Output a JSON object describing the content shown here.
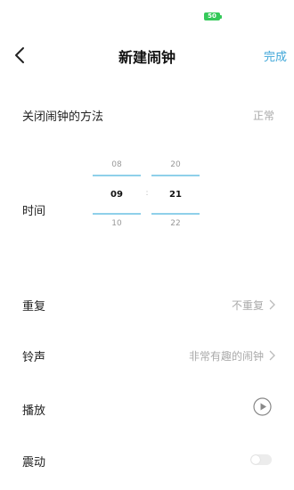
{
  "status_bar": {
    "battery_text": "50"
  },
  "header": {
    "title": "新建闹钟",
    "done_label": "完成"
  },
  "close_method": {
    "label": "关闭闹钟的方法",
    "value": "正常"
  },
  "time": {
    "label": "时间",
    "hours": {
      "prev": "08",
      "selected": "09",
      "next": "10"
    },
    "minutes": {
      "prev": "20",
      "selected": "21",
      "next": "22"
    },
    "separator": ":"
  },
  "repeat": {
    "label": "重复",
    "value": "不重复"
  },
  "ringtone": {
    "label": "铃声",
    "value": "非常有趣的闹钟"
  },
  "play": {
    "label": "播放"
  },
  "vibrate": {
    "label": "震动",
    "enabled": false
  },
  "colors": {
    "accent": "#3fa6d8",
    "picker_line": "#8fd0ea",
    "battery": "#35c95a"
  }
}
